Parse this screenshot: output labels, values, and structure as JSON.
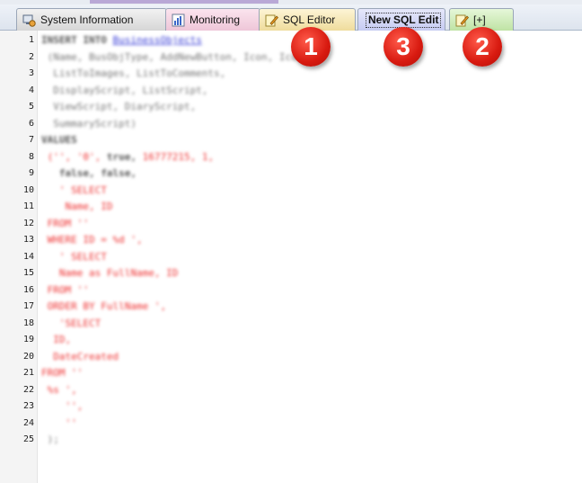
{
  "tabs": [
    {
      "label": "System Information",
      "icon": "computer-info-icon"
    },
    {
      "label": "Monitoring",
      "icon": "bar-chart-icon"
    },
    {
      "label": "SQL Editor",
      "icon": "pencil-note-icon"
    },
    {
      "label": "New SQL Edit",
      "icon": "",
      "active": true
    },
    {
      "label": "[+]",
      "icon": "pencil-note-icon"
    }
  ],
  "callouts": [
    "1",
    "3",
    "2"
  ],
  "line_numbers": [
    "1",
    "2",
    "3",
    "4",
    "5",
    "6",
    "7",
    "8",
    "9",
    "10",
    "11",
    "12",
    "13",
    "14",
    "15",
    "16",
    "17",
    "18",
    "19",
    "20",
    "21",
    "22",
    "23",
    "24",
    "25"
  ],
  "code_lines": [
    [
      {
        "t": "INSERT INTO ",
        "c": "k"
      },
      {
        "t": "BusinessObjects",
        "c": "b"
      }
    ],
    [
      {
        "t": " (Name, BusObjType, AddNewButton, Icon, Ico",
        "c": "g"
      }
    ],
    [
      {
        "t": "  ListToImages, ListToComments,",
        "c": "g"
      }
    ],
    [
      {
        "t": "  DisplayScript, ListScript,",
        "c": "g"
      }
    ],
    [
      {
        "t": "  ViewScript, DiaryScript,",
        "c": "g"
      }
    ],
    [
      {
        "t": "  SummaryScript)",
        "c": "g"
      }
    ],
    [
      {
        "t": "VALUES",
        "c": "k"
      }
    ],
    [
      {
        "t": " ('', '0', ",
        "c": "r"
      },
      {
        "t": "true, ",
        "c": "k"
      },
      {
        "t": "16777215, 1,",
        "c": "r"
      }
    ],
    [
      {
        "t": "   false, false,",
        "c": "k"
      }
    ],
    [
      {
        "t": "   ' SELECT",
        "c": "r"
      }
    ],
    [
      {
        "t": "    Name, ID",
        "c": "r"
      }
    ],
    [
      {
        "t": " FROM ''",
        "c": "r"
      }
    ],
    [
      {
        "t": " WHERE ID = %d ',",
        "c": "r"
      }
    ],
    [
      {
        "t": "   ' SELECT",
        "c": "r"
      }
    ],
    [
      {
        "t": "   Name as FullName, ID",
        "c": "r"
      }
    ],
    [
      {
        "t": " FROM ''",
        "c": "r"
      }
    ],
    [
      {
        "t": " ORDER BY FullName ',",
        "c": "r"
      }
    ],
    [
      {
        "t": "   'SELECT",
        "c": "r"
      }
    ],
    [
      {
        "t": "  ID,",
        "c": "r"
      }
    ],
    [
      {
        "t": "  DateCreated",
        "c": "r"
      }
    ],
    [
      {
        "t": "FROM ''",
        "c": "r"
      }
    ],
    [
      {
        "t": " %s ',",
        "c": "r"
      }
    ],
    [
      {
        "t": "    '',",
        "c": "r"
      }
    ],
    [
      {
        "t": "    ''",
        "c": "r"
      }
    ],
    [
      {
        "t": " );",
        "c": "g"
      }
    ]
  ],
  "colors": {
    "keyword": "#555555",
    "link": "#3a3fd8",
    "string": "#ee3030",
    "plain": "#777777",
    "badge": "#d81a10"
  }
}
